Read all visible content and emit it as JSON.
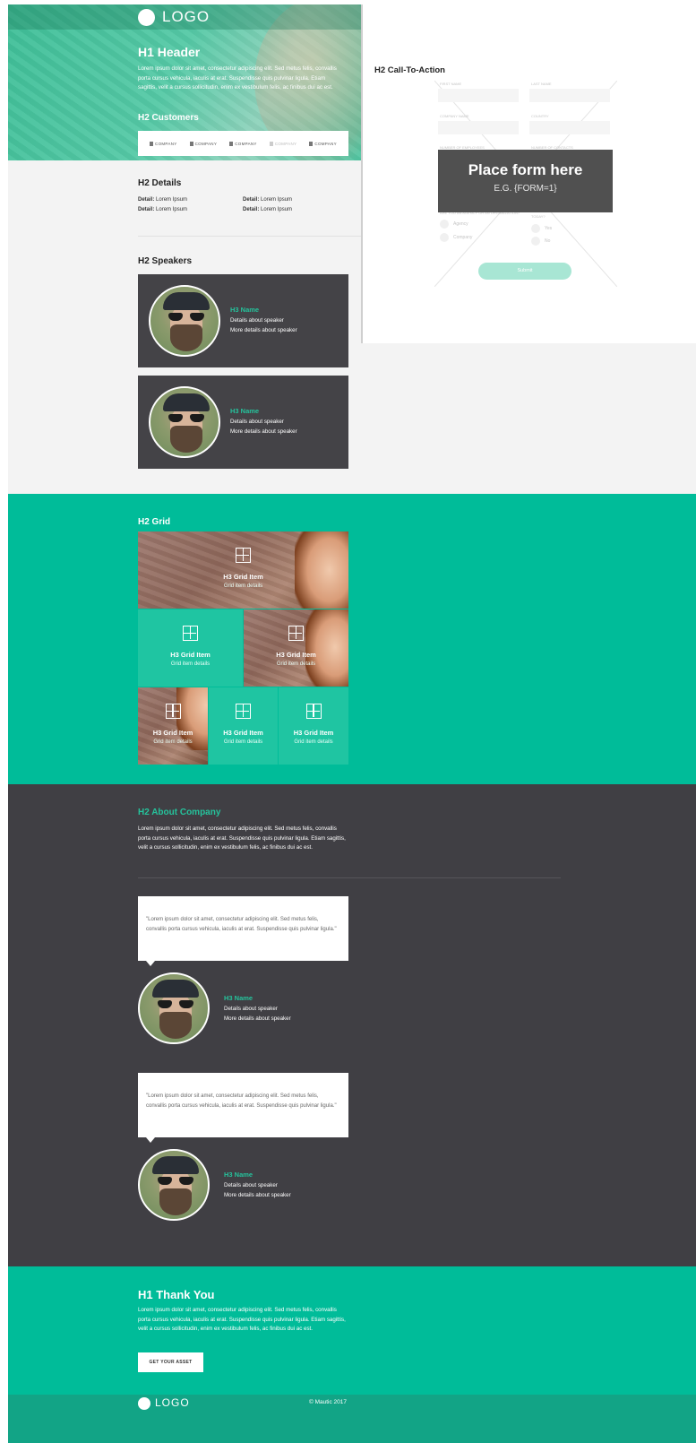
{
  "brand": {
    "logo_text": "LOGO"
  },
  "hero": {
    "h1": "H1 Header",
    "paragraph": "Lorem ipsum dolor sit amet, consectetur adipiscing elit. Sed metus felis, convallis porta cursus vehicula, iaculis at erat. Suspendisse quis pulvinar ligula. Etiam sagittis, velit a cursus sollicitudin, enim ex vestibulum felis, ac finibus dui ac est.",
    "customers_title": "H2 Customers",
    "customers": [
      "COMPANY",
      "COMPANY",
      "COMPANY",
      "COMPANY",
      "COMPANY"
    ]
  },
  "cta": {
    "title": "H2 Call-To-Action",
    "labels": {
      "first_name": "FIRST NAME",
      "last_name": "LAST NAME",
      "company_name": "COMPANY NAME",
      "country": "COUNTRY",
      "employees": "NUMBER OF EMPLOYEES",
      "contacts": "NUMBER OF CONTACTS",
      "org": "ARE YOU AN AGENCY OR AN ORGANIZATION?",
      "today": "TODAY?"
    },
    "radios": {
      "agency": "Agency",
      "company": "Company",
      "yes": "Yes",
      "no": "No"
    },
    "submit": "Submit",
    "placeholder_title": "Place form here",
    "placeholder_sub": "E.G. {FORM=1}"
  },
  "details": {
    "title": "H2 Details",
    "items": [
      {
        "label": "Detail:",
        "value": "Lorem Ipsum"
      },
      {
        "label": "Detail:",
        "value": "Lorem Ipsum"
      },
      {
        "label": "Detail:",
        "value": "Lorem Ipsum"
      },
      {
        "label": "Detail:",
        "value": "Lorem Ipsum"
      }
    ]
  },
  "speakers": {
    "title": "H2 Speakers",
    "items": [
      {
        "name": "H3 Name",
        "line1": "Details about speaker",
        "line2": "More details about speaker"
      },
      {
        "name": "H3 Name",
        "line1": "Details about speaker",
        "line2": "More details about speaker"
      }
    ]
  },
  "grid": {
    "title": "H2 Grid",
    "items": [
      {
        "title": "H3 Grid Item",
        "details": "Grid item details"
      },
      {
        "title": "H3 Grid Item",
        "details": "Grid item details"
      },
      {
        "title": "H3 Grid Item",
        "details": "Grid item details"
      },
      {
        "title": "H3 Grid Item",
        "details": "Grid item details"
      },
      {
        "title": "H3 Grid Item",
        "details": "Grid item details"
      },
      {
        "title": "H3 Grid Item",
        "details": "Grid item details"
      }
    ]
  },
  "about": {
    "title": "H2 About Company",
    "paragraph": "Lorem ipsum dolor sit amet, consectetur adipiscing elit. Sed metus felis, convallis porta cursus vehicula, iaculis at erat. Suspendisse quis pulvinar ligula. Etiam sagittis, velit a cursus sollicitudin, enim ex vestibulum felis, ac finibus dui ac est.",
    "testimonials": [
      {
        "quote": "\"Lorem ipsum dolor sit amet, consectetur adipiscing elit. Sed metus felis, convallis porta cursus vehicula, iaculis at erat. Suspendisse quis pulvinar ligula.\"",
        "name": "H3 Name",
        "line1": "Details about speaker",
        "line2": "More details about speaker"
      },
      {
        "quote": "\"Lorem ipsum dolor sit amet, consectetur adipiscing elit. Sed metus felis, convallis porta cursus vehicula, iaculis at erat. Suspendisse quis pulvinar ligula.\"",
        "name": "H3 Name",
        "line1": "Details about speaker",
        "line2": "More details about speaker"
      }
    ]
  },
  "thanks": {
    "h1": "H1 Thank You",
    "paragraph": "Lorem ipsum dolor sit amet, consectetur adipiscing elit. Sed metus felis, convallis porta cursus vehicula, iaculis at erat. Suspendisse quis pulvinar ligula. Etiam sagittis, velit a cursus sollicitudin, enim ex vestibulum felis, ac finibus dui ac est.",
    "button": "GET YOUR ASSET"
  },
  "footer": {
    "logo_text": "LOGO",
    "copyright": "© Mautic 2017"
  },
  "colors": {
    "accent": "#00bc99",
    "dark": "#403f44",
    "speaker_card": "#444347",
    "light_bg": "#f3f3f3"
  }
}
